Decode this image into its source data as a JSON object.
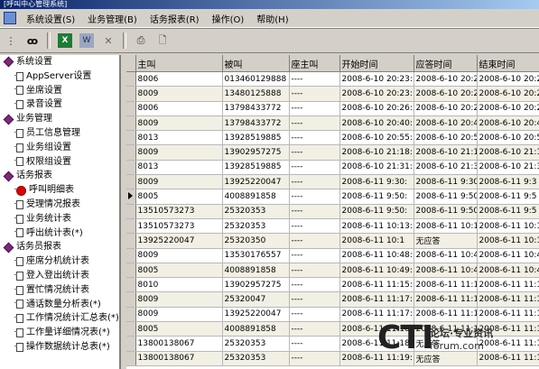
{
  "window": {
    "title": "[呼叫中心管理系统]"
  },
  "menu": [
    "系统设置(S)",
    "业务管理(B)",
    "话务报表(R)",
    "操作(O)",
    "帮助(H)"
  ],
  "toolbar": [
    {
      "name": "tree-view-icon",
      "glyph": "⋮"
    },
    {
      "name": "binoculars-icon",
      "glyph": "ꝏ"
    },
    {
      "name": "excel-export-icon",
      "glyph": "X"
    },
    {
      "name": "word-export-icon",
      "glyph": "W"
    },
    {
      "name": "close-doc-icon",
      "glyph": "✕"
    },
    {
      "name": "print-icon",
      "glyph": "⎙"
    },
    {
      "name": "page-icon",
      "glyph": "🗋"
    }
  ],
  "tree": [
    {
      "type": "group",
      "label": "系统设置"
    },
    {
      "type": "leaf",
      "label": "AppServer设置"
    },
    {
      "type": "leaf",
      "label": "坐席设置"
    },
    {
      "type": "leaf",
      "label": "录音设置"
    },
    {
      "type": "group",
      "label": "业务管理"
    },
    {
      "type": "leaf",
      "label": "员工信息管理"
    },
    {
      "type": "leaf",
      "label": "业务组设置"
    },
    {
      "type": "leaf",
      "label": "权限组设置"
    },
    {
      "type": "group",
      "label": "话务报表"
    },
    {
      "type": "leaf",
      "label": "呼叫明细表",
      "active": true
    },
    {
      "type": "leaf",
      "label": "受理情况报表"
    },
    {
      "type": "leaf",
      "label": "业务统计表"
    },
    {
      "type": "leaf",
      "label": "呼出统计表(*)"
    },
    {
      "type": "group",
      "label": "话务员报表"
    },
    {
      "type": "leaf",
      "label": "座席分机统计表"
    },
    {
      "type": "leaf",
      "label": "登入登出统计表"
    },
    {
      "type": "leaf",
      "label": "置忙情况统计表"
    },
    {
      "type": "leaf",
      "label": "通话数量分析表(*)"
    },
    {
      "type": "leaf",
      "label": "工作情况统计汇总表(*)"
    },
    {
      "type": "leaf",
      "label": "工作量详细情况表(*)"
    },
    {
      "type": "leaf",
      "label": "操作数据统计总表(*)"
    }
  ],
  "grid": {
    "columns": [
      "",
      "主叫",
      "被叫",
      "座主叫",
      "开始时间",
      "应答时间",
      "结束时间"
    ],
    "rows": [
      {
        "cells": [
          "8006",
          "013460129888",
          "----",
          "2008-6-10 20:23:",
          "2008-6-10 20:2",
          "2008-6-10 20:2"
        ],
        "shaded": false
      },
      {
        "cells": [
          "8009",
          "13480125888",
          "----",
          "2008-6-10 20:23:",
          "2008-6-10 20:2",
          "2008-6-10 20:2"
        ],
        "shaded": true
      },
      {
        "cells": [
          "8006",
          "13798433772",
          "----",
          "2008-6-10 20:26:",
          "2008-6-10 20:2",
          "2008-6-10 20:2"
        ],
        "shaded": false
      },
      {
        "cells": [
          "8009",
          "13798433772",
          "----",
          "2008-6-10 20:40:",
          "2008-6-10 20:4",
          "2008-6-10 20:4"
        ],
        "shaded": true
      },
      {
        "cells": [
          "8013",
          "13928519885",
          "----",
          "2008-6-10 20:55:",
          "2008-6-10 20:5",
          "2008-6-10 20:5"
        ],
        "shaded": false
      },
      {
        "cells": [
          "8009",
          "13902957275",
          "----",
          "2008-6-10 21:18:",
          "2008-6-10 21:1",
          "2008-6-10 21:1"
        ],
        "shaded": true
      },
      {
        "cells": [
          "8013",
          "13928519885",
          "----",
          "2008-6-10 21:31:",
          "2008-6-10 21:3",
          "2008-6-10 21:3"
        ],
        "shaded": false
      },
      {
        "cells": [
          "8009",
          "13925220047",
          "----",
          "2008-6-11 9:30:",
          "2008-6-11 9:30",
          "2008-6-11 9:3"
        ],
        "shaded": true
      },
      {
        "cells": [
          "8005",
          "4008891858",
          "----",
          "2008-6-11 9:50:",
          "2008-6-11 9:50",
          "2008-6-11 9:5"
        ],
        "shaded": false,
        "selected": true
      },
      {
        "cells": [
          "13510573273",
          "25320353",
          "----",
          "2008-6-11 9:50:",
          "2008-6-11 9:50",
          "2008-6-11 9:5"
        ],
        "shaded": true
      },
      {
        "cells": [
          "13510573273",
          "25320353",
          "----",
          "2008-6-11 10:13:",
          "2008-6-11 10:1",
          "2008-6-11 10:1"
        ],
        "shaded": false
      },
      {
        "cells": [
          "13925220047",
          "25320350",
          "----",
          "2008-6-11 10:1",
          "无应答",
          "2008-6-11 10:1"
        ],
        "shaded": true
      },
      {
        "cells": [
          "8009",
          "13530176557",
          "----",
          "2008-6-11 10:48:",
          "2008-6-11 10:4",
          "2008-6-11 10:4"
        ],
        "shaded": false
      },
      {
        "cells": [
          "8005",
          "4008891858",
          "----",
          "2008-6-11 10:49:",
          "2008-6-11 10:4",
          "2008-6-11 10:4"
        ],
        "shaded": true
      },
      {
        "cells": [
          "8010",
          "13902957275",
          "----",
          "2008-6-11 11:15:",
          "2008-6-11 11:1",
          "2008-6-11 11:1"
        ],
        "shaded": false
      },
      {
        "cells": [
          "8009",
          "25320047",
          "----",
          "2008-6-11 11:17:",
          "2008-6-11 11:1",
          "2008-6-11 11:1"
        ],
        "shaded": true
      },
      {
        "cells": [
          "8009",
          "13925220047",
          "----",
          "2008-6-11 11:17:",
          "2008-6-11 11:1",
          "2008-6-11 11:1"
        ],
        "shaded": false
      },
      {
        "cells": [
          "8005",
          "4008891858",
          "----",
          "2008-6-11 11:18:",
          "2008-6-11 11:1",
          "2008-6-11 11:1"
        ],
        "shaded": true
      },
      {
        "cells": [
          "13800138067",
          "25320353",
          "----",
          "2008-6-11 11:18:",
          "无应答",
          "2008-6-11 11:1"
        ],
        "shaded": false
      },
      {
        "cells": [
          "13800138067",
          "25320353",
          "----",
          "2008-6-11 11:19:",
          "无应答",
          "2008-6-11 11:1"
        ],
        "shaded": true
      }
    ]
  },
  "watermark": {
    "logo": "CTI",
    "text": "论坛·专业资讯",
    "url": "forum.com"
  }
}
